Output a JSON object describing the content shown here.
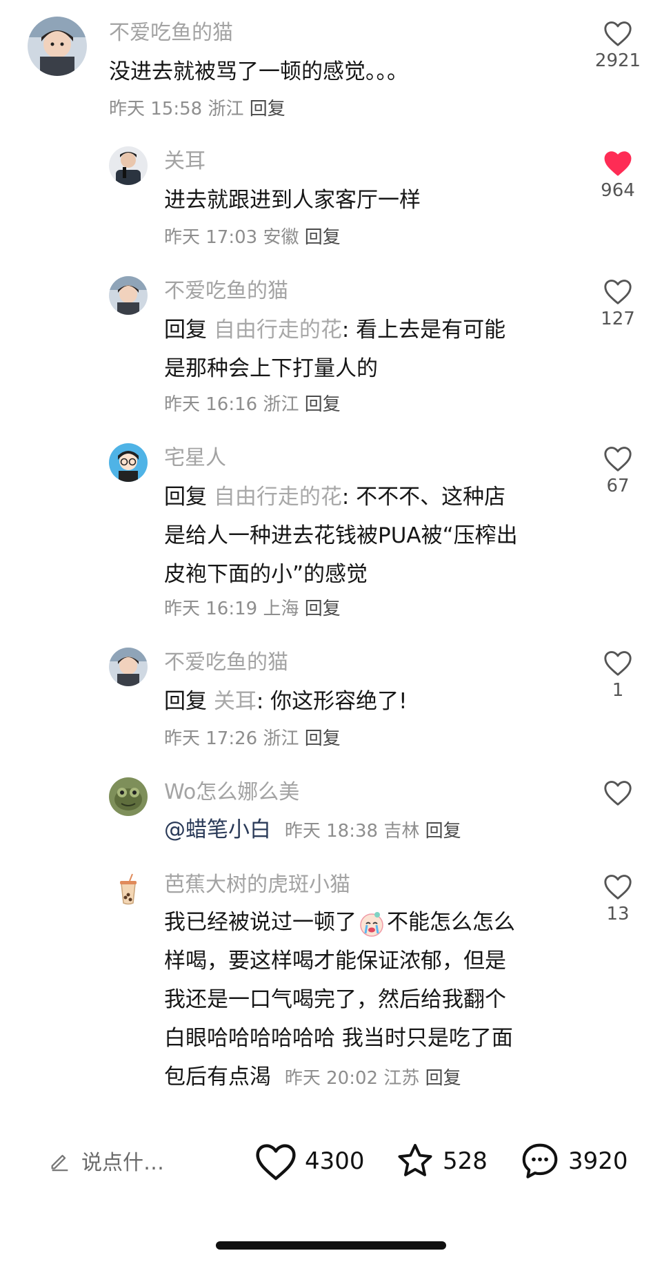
{
  "comments": [
    {
      "username": "不爱吃鱼的猫",
      "text": "没进去就被骂了一顿的感觉。。。",
      "time": "昨天 15:58",
      "location": "浙江",
      "reply_label": "回复",
      "likes": "2921",
      "liked": false
    },
    {
      "username": "关耳",
      "text": "进去就跟进到人家客厅一样",
      "time": "昨天 17:03",
      "location": "安徽",
      "reply_label": "回复",
      "likes": "964",
      "liked": true
    },
    {
      "username": "不爱吃鱼的猫",
      "reply_word": "回复",
      "reply_target": "自由行走的花",
      "text_line1": ": 看上去是有可能",
      "text_line2": "是那种会上下打量人的",
      "time": "昨天 16:16",
      "location": "浙江",
      "reply_label": "回复",
      "likes": "127",
      "liked": false
    },
    {
      "username": "宅星人",
      "reply_word": "回复",
      "reply_target": "自由行走的花",
      "text_line1": ": 不不不、这种店",
      "text_line2": "是给人一种进去花钱被PUA被“压榨出",
      "text_line3": "皮袍下面的小”的感觉",
      "time": "昨天 16:19",
      "location": "上海",
      "reply_label": "回复",
      "likes": "67",
      "liked": false
    },
    {
      "username": "不爱吃鱼的猫",
      "reply_word": "回复",
      "reply_target": "关耳",
      "text_line1": ": 你这形容绝了!",
      "time": "昨天 17:26",
      "location": "浙江",
      "reply_label": "回复",
      "likes": "1",
      "liked": false
    },
    {
      "username": "Wo怎么娜么美",
      "mention": "@蜡笔小白",
      "time": "昨天 18:38",
      "location": "吉林",
      "reply_label": "回复",
      "likes": "",
      "liked": false
    },
    {
      "username": "芭蕉大树的虎斑小猫",
      "line1_a": "我已经被说过一顿了",
      "line1_b": "不能怎么怎么",
      "line2": "样喝，要这样喝才能保证浓郁，但是",
      "line3": "我还是一口气喝完了，然后给我翻个",
      "line4": "白眼哈哈哈哈哈哈 我当时只是吃了面",
      "line5": "包后有点渴",
      "time": "昨天 20:02",
      "location": "江苏",
      "reply_label": "回复",
      "likes": "13",
      "liked": false
    }
  ],
  "bottom_bar": {
    "input_placeholder": "说点什…",
    "likes_count": "4300",
    "favorites_count": "528",
    "comments_count": "3920"
  },
  "colors": {
    "liked_heart": "#fe2c55",
    "muted_text": "#a3a3a3",
    "primary_text": "#161616"
  }
}
